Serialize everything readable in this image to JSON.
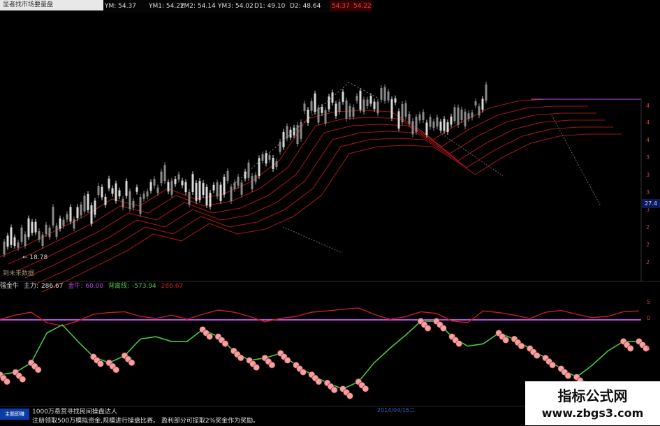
{
  "header": {
    "title": "显者找市场要量盘",
    "ma_labels": [
      {
        "name": "YM",
        "value": "54.37"
      },
      {
        "name": "YM1",
        "value": "54.22"
      },
      {
        "name": "YM2",
        "value": "54.14"
      },
      {
        "name": "YM3",
        "value": "54.02"
      },
      {
        "name": "D1",
        "value": "49.10"
      },
      {
        "name": "D2",
        "value": "48.64"
      }
    ],
    "highlight_values": [
      "54.37",
      "54.22"
    ]
  },
  "price_panel": {
    "low_label": "18.78",
    "future_label": "到未来数据",
    "price_tag": "27.4",
    "y_ticks": [
      "4",
      "4",
      "4",
      "3",
      "3",
      "3",
      "3",
      "2",
      "2",
      "2"
    ]
  },
  "indicator": {
    "name": "强金牛",
    "main_label": "主力:",
    "main_value": "286.67",
    "series2_label": "金牛:",
    "series2_value": "60.00",
    "series3_label": "背离线:",
    "series3_value": "-573.94",
    "series4_value": "286.67",
    "y_ticks": [
      "5",
      "0",
      "5"
    ]
  },
  "footer": {
    "brand": "主题即赚",
    "ad_line1": "1000万悬赏寻找民间操盘达人",
    "ad_line2": "注册领取500万模拟资金,规模进行操盘比赛。 盈利部分可提取2%奖金作为奖励。",
    "date_tag": "2014/04/15二"
  },
  "watermark": {
    "line1": "指标公式网",
    "line2": "www.zbgs3.com"
  },
  "colors": {
    "background": "#000000",
    "ma_red": "#b81a1a",
    "candle": "#cfcfcf",
    "indicator_red": "#c8201f",
    "indicator_green": "#48c83a",
    "baseline_purple": "#b94ce0",
    "ball": "#f2a0a0"
  },
  "chart_data": {
    "type": "line",
    "description_series": [
      {
        "name": "主力",
        "values": [
          0.62,
          0.52,
          0.45,
          0.7,
          0.78,
          0.66,
          0.5,
          0.46,
          0.44,
          0.55,
          0.6,
          0.52,
          0.62,
          0.5,
          0.4,
          0.45,
          0.55,
          0.68,
          0.6,
          0.55,
          0.45,
          0.42,
          0.38,
          0.35,
          0.5,
          0.62,
          0.56,
          0.44,
          0.48,
          0.66,
          0.7,
          0.42,
          0.46,
          0.52,
          0.6,
          0.45,
          0.41,
          0.5,
          0.58,
          0.55,
          0.44,
          0.42
        ]
      },
      {
        "name": "背离线",
        "values": [
          0.9,
          0.88,
          0.8,
          0.55,
          0.48,
          0.62,
          0.75,
          0.8,
          0.74,
          0.6,
          0.58,
          0.62,
          0.62,
          0.52,
          0.58,
          0.7,
          0.78,
          0.76,
          0.72,
          0.82,
          0.9,
          0.97,
          1.02,
          0.96,
          0.8,
          0.68,
          0.57,
          0.45,
          0.45,
          0.58,
          0.66,
          0.64,
          0.55,
          0.6,
          0.68,
          0.76,
          0.85,
          0.92,
          0.82,
          0.7,
          0.62,
          0.62
        ]
      }
    ]
  }
}
